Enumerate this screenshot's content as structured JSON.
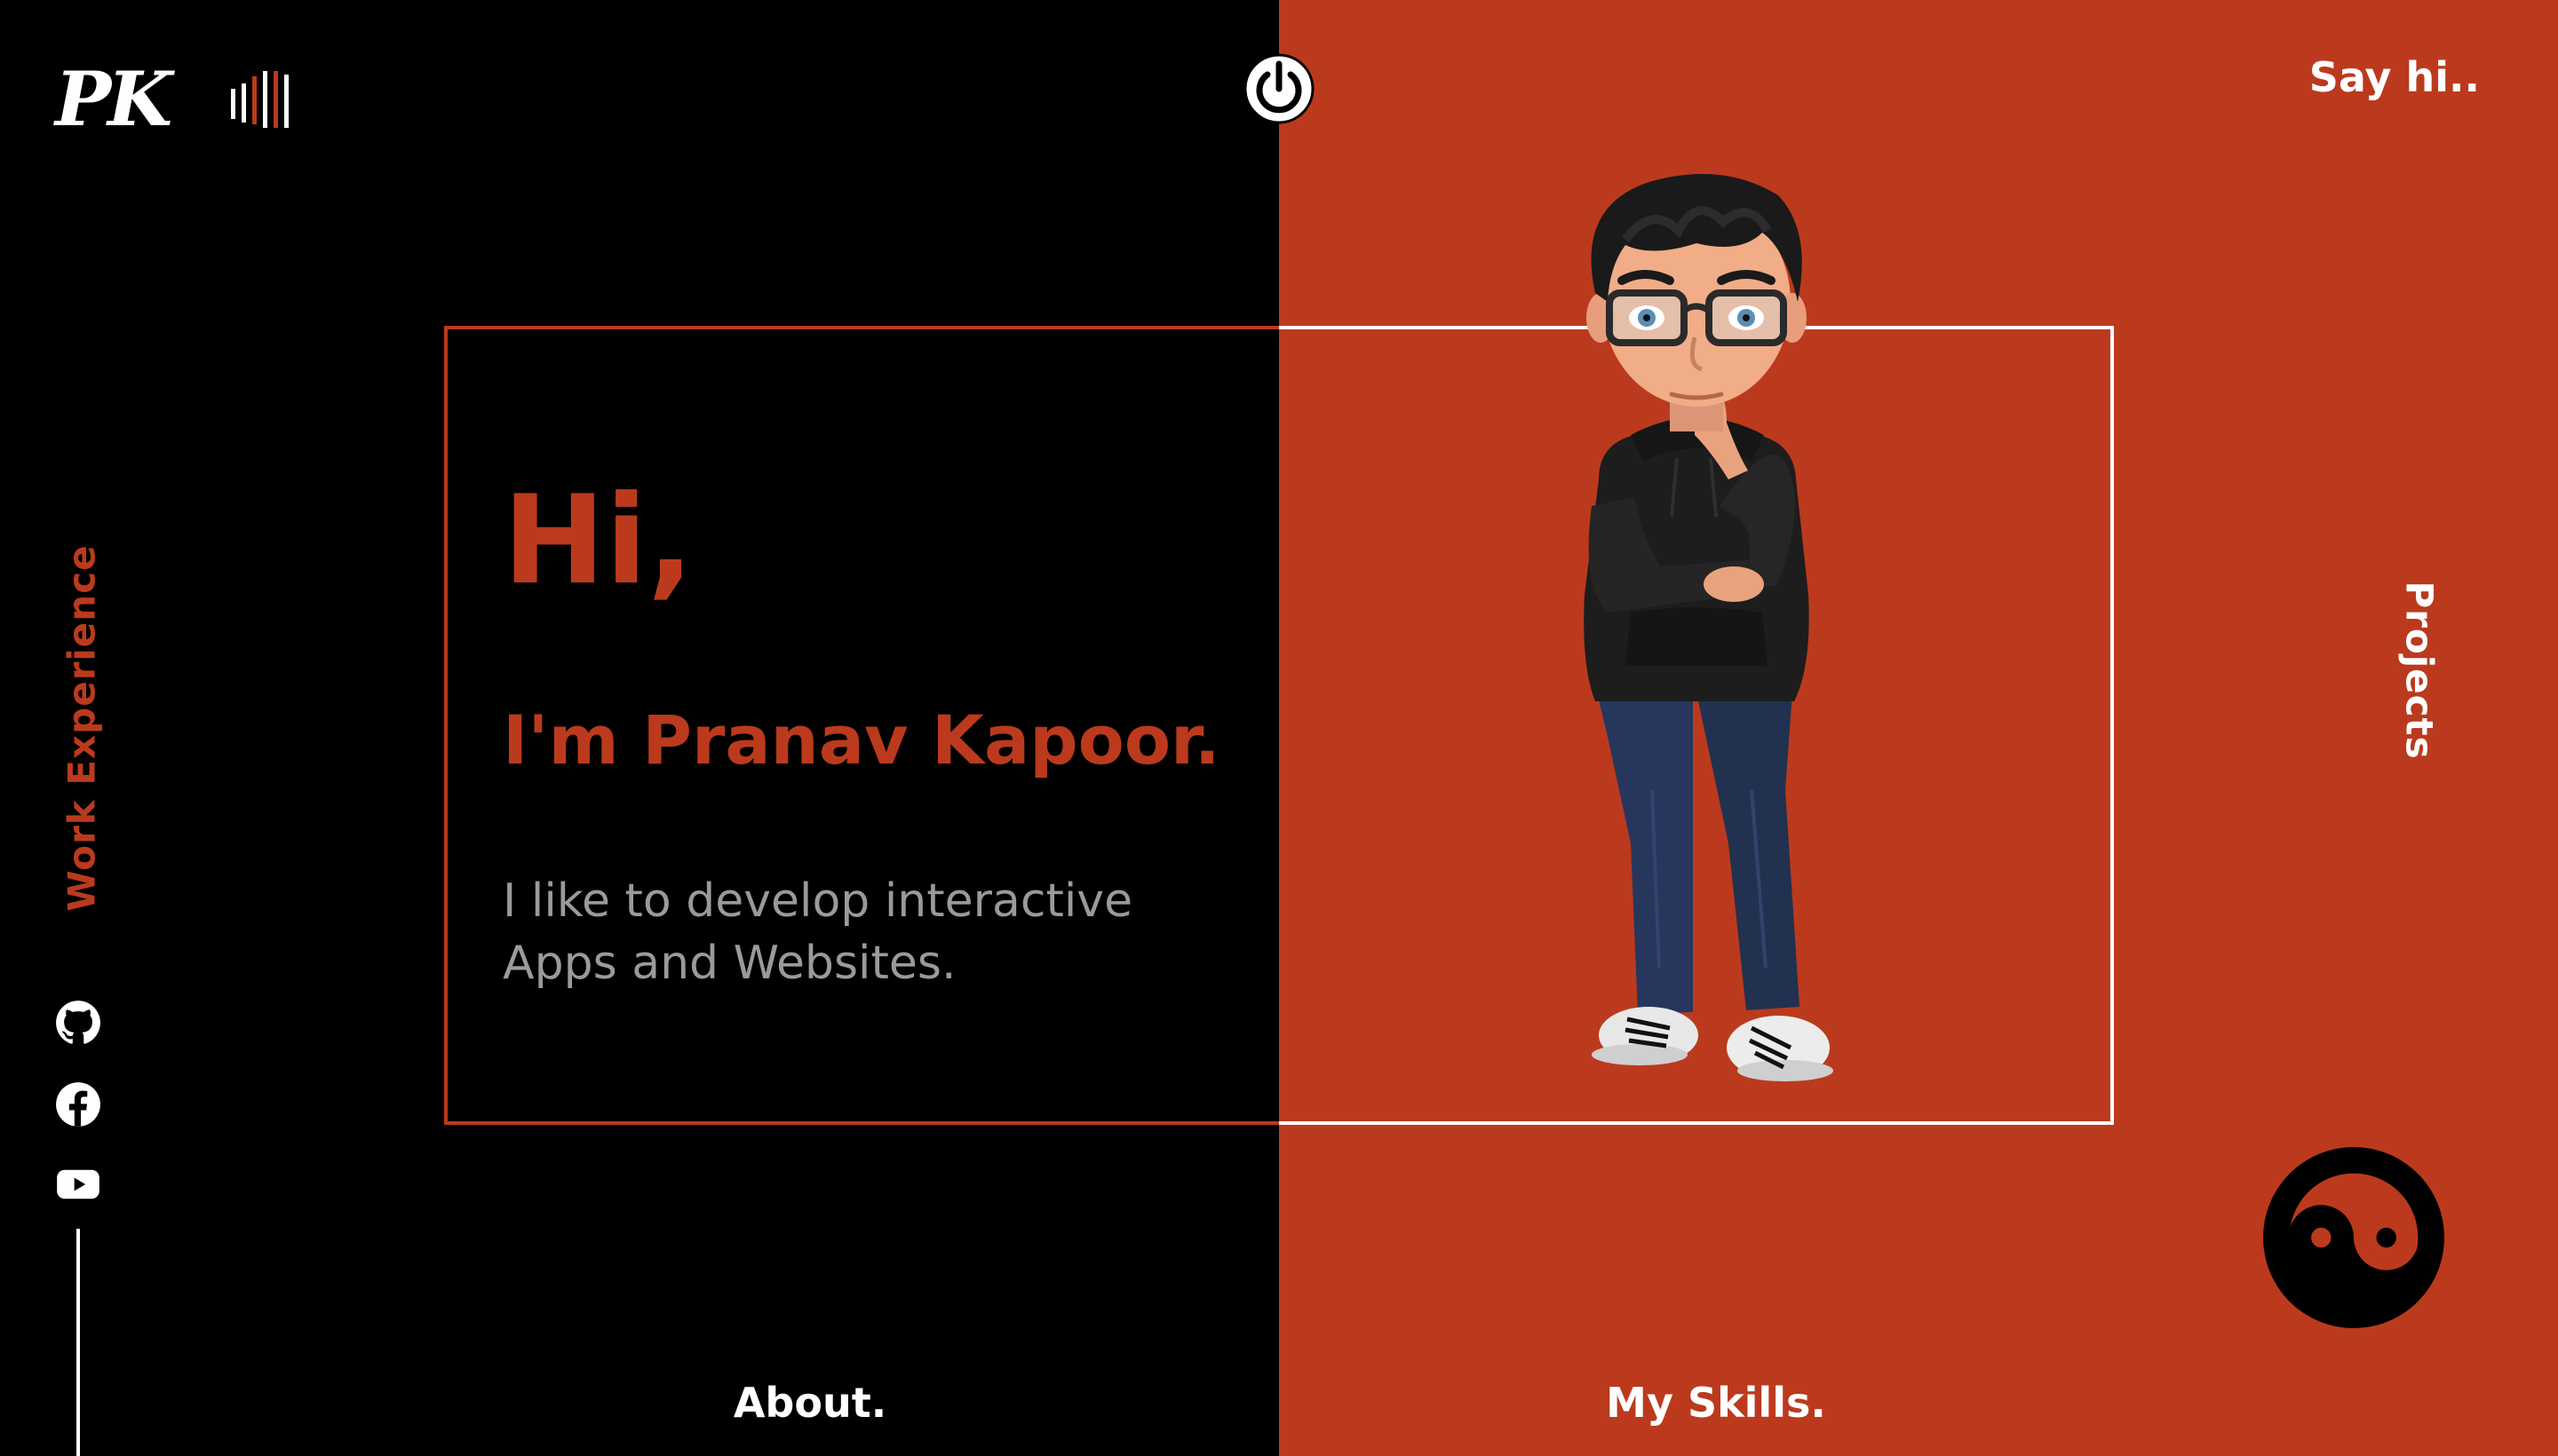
{
  "header": {
    "logo": "PK",
    "sound_icon": "sound-bars-icon",
    "center_icon": "power-icon",
    "say_hi": "Say hi.."
  },
  "nav": {
    "left_vertical": "Work Experience",
    "right_vertical": "Projects",
    "bottom_left": "About.",
    "bottom_right": "My Skills."
  },
  "hero": {
    "greeting": "Hi,",
    "name": "I'm Pranav Kapoor.",
    "tagline": "I like to develop interactive Apps and Websites."
  },
  "social": [
    {
      "icon": "github-icon"
    },
    {
      "icon": "facebook-icon"
    },
    {
      "icon": "youtube-icon"
    }
  ],
  "decor": {
    "theme_toggle_icon": "yin-yang-icon",
    "avatar": "avatar-illustration"
  },
  "colors": {
    "accent": "#bb3a1d",
    "dark": "#000000",
    "light": "#ffffff",
    "muted": "#9a9a9a"
  }
}
